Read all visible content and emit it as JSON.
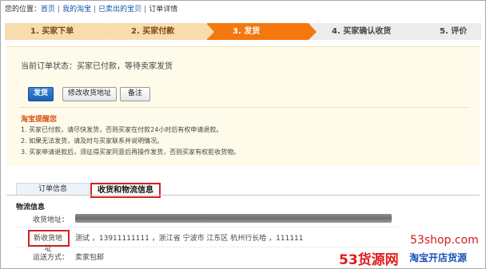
{
  "breadcrumb": {
    "prefix": "您的位置：",
    "items": [
      "首页",
      "我的淘宝",
      "已卖出的宝贝"
    ],
    "current": "订单详情",
    "separator": "|"
  },
  "steps": [
    {
      "label": "1. 买家下单",
      "state": "done"
    },
    {
      "label": "2. 买家付款",
      "state": "done"
    },
    {
      "label": "3. 发货",
      "state": "active"
    },
    {
      "label": "4. 买家确认收货",
      "state": "todo"
    },
    {
      "label": "5. 评价",
      "state": "todo"
    }
  ],
  "status": {
    "text": "当前订单状态：买家已付款，等待卖家发货",
    "buttons": {
      "ship": "发货",
      "modify_address": "修改收货地址",
      "memo": "备注"
    }
  },
  "reminder": {
    "title": "淘宝提醒您",
    "lines": [
      "1. 买家已付款，请尽快发货，否则买家在付款24小时后有权申请退款。",
      "2. 如果无法发货，请及时与买家联系并说明情况。",
      "3. 买家申请退款后，须征得买家同意后再操作发货，否则买家有权拒收货物。"
    ]
  },
  "tabs": {
    "order_info": "订单信息",
    "logistics": "收货和物流信息"
  },
  "logistics": {
    "section_title": "物流信息",
    "address_label": "收货地址：",
    "new_address_label": "新收货地址",
    "new_address_value": "测试 ，13911111111 ，浙江省 宁波市 江东区 杭州行长哈 ，111111",
    "shipping_label": "运送方式：",
    "shipping_value": "卖家包邮"
  },
  "watermark": {
    "domain": "53shop.com",
    "brand": "53货源网",
    "slogan": "淘宝开店货源"
  },
  "colors": {
    "step_done": "#f7dcae",
    "step_active": "#f5780f",
    "step_todo": "#ececec",
    "primary_button": "#1d60b3",
    "highlight": "#d42020"
  }
}
